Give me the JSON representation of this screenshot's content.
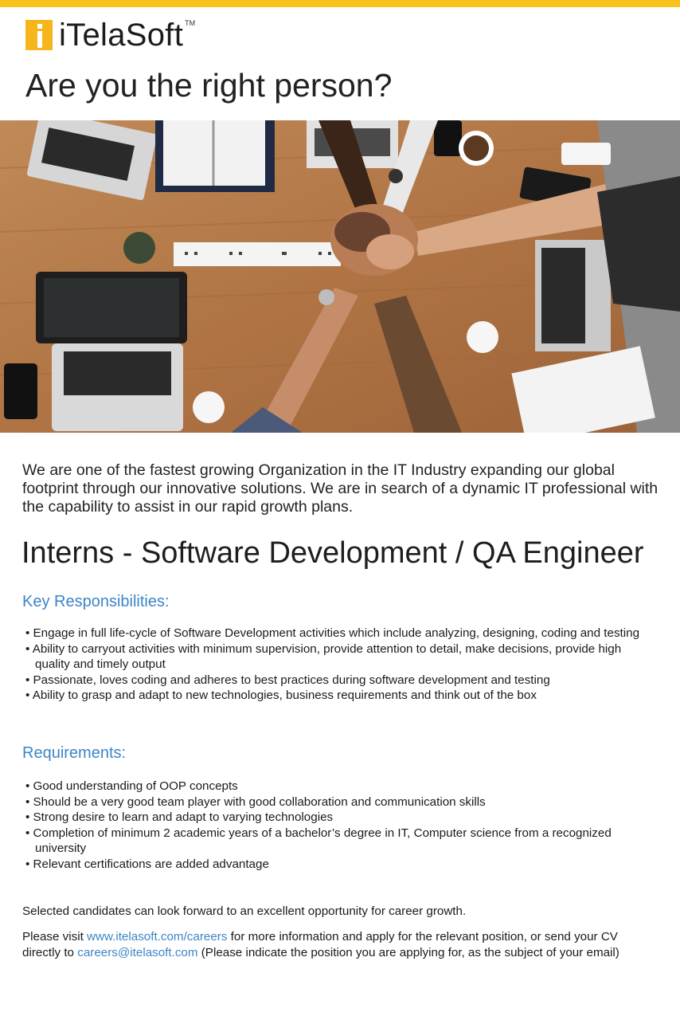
{
  "brand": {
    "name": "iTelaSoft",
    "tm": "TM",
    "accent_color": "#f7c21b",
    "link_color": "#3d85c6"
  },
  "headline": "Are you the right person?",
  "hero_image": {
    "icon": "teamwork-hands-photo"
  },
  "intro": "We are one of the fastest growing Organization in the IT Industry expanding our global footprint through our innovative solutions. We are in search of a dynamic IT professional with the capability to assist in our rapid growth plans.",
  "job_title": "Interns - Software Development / QA Engineer",
  "responsibilities": {
    "heading": "Key Responsibilities:",
    "items": [
      "Engage in full life-cycle of Software Development activities which include analyzing, designing, coding and testing",
      "Ability to carryout activities with minimum supervision, provide attention to detail, make decisions, provide high quality and timely output",
      "Passionate, loves coding and adheres to best practices during software development and testing",
      "Ability to grasp and adapt to new technologies, business requirements and think out of the box"
    ]
  },
  "requirements": {
    "heading": "Requirements:",
    "items": [
      "Good understanding of OOP concepts",
      "Should be a very good team player with good collaboration and communication skills",
      "Strong desire to learn and adapt to varying technologies",
      "Completion of minimum 2 academic years of a bachelor’s degree in IT, Computer science from a recognized university",
      "Relevant certifications are added advantage"
    ]
  },
  "closing": "Selected candidates can look forward to an excellent opportunity for career growth.",
  "apply": {
    "part1": "Please visit ",
    "url": "www.itelasoft.com/careers",
    "part2": " for more information and apply for the relevant position, or send your CV directly to ",
    "email": "careers@itelasoft.com",
    "part3": " (Please indicate the position you are applying for, as the subject of your email)"
  }
}
